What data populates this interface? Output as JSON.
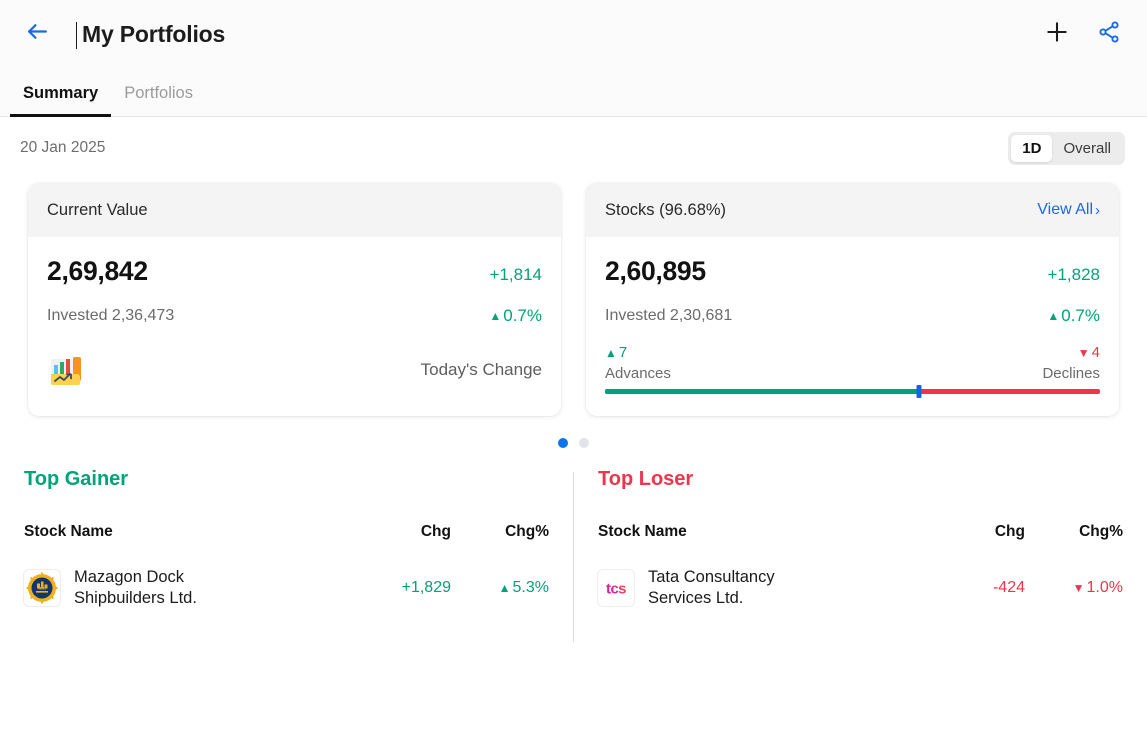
{
  "header": {
    "title": "My Portfolios",
    "back_icon": "arrow-left-icon",
    "add_icon": "plus-icon",
    "share_icon": "share-icon"
  },
  "tabs": [
    {
      "label": "Summary",
      "active": true
    },
    {
      "label": "Portfolios",
      "active": false
    }
  ],
  "subbar": {
    "date": "20 Jan 2025",
    "range_options": [
      {
        "label": "1D",
        "active": true
      },
      {
        "label": "Overall",
        "active": false
      }
    ]
  },
  "cards": {
    "current_value": {
      "header_title": "Current Value",
      "value": "2,69,842",
      "delta": "+1,814",
      "invested": "Invested 2,36,473",
      "pct": "0.7%",
      "pct_direction": "up",
      "icon": "bar-chart-emoji",
      "footer_label": "Today's Change"
    },
    "stocks": {
      "header_title": "Stocks (96.68%)",
      "view_all": "View All",
      "view_all_chevron": "›",
      "value": "2,60,895",
      "delta": "+1,828",
      "invested": "Invested 2,30,681",
      "pct": "0.7%",
      "pct_direction": "up",
      "advances_count": "7",
      "declines_count": "4",
      "advances_label": "Advances",
      "declines_label": "Declines",
      "advances_bar_percent": 63.5
    }
  },
  "carousel": {
    "dots": [
      {
        "active": true
      },
      {
        "active": false
      }
    ]
  },
  "top_gainer": {
    "title": "Top Gainer",
    "columns": {
      "name": "Stock Name",
      "chg": "Chg",
      "chg_pct": "Chg%"
    },
    "rows": [
      {
        "logo": "mazagon-dock-logo",
        "name_line1": "Mazagon Dock",
        "name_line2": "Shipbuilders Ltd.",
        "chg": "+1,829",
        "chg_pct": "5.3%",
        "direction": "up"
      }
    ]
  },
  "top_loser": {
    "title": "Top Loser",
    "columns": {
      "name": "Stock Name",
      "chg": "Chg",
      "chg_pct": "Chg%"
    },
    "rows": [
      {
        "logo": "tcs-logo",
        "name_line1": "Tata Consultancy",
        "name_line2": "Services Ltd.",
        "chg": "-424",
        "chg_pct": "1.0%",
        "direction": "down"
      }
    ]
  },
  "colors": {
    "positive": "#00a37a",
    "negative": "#f0344b",
    "link": "#1a6ae0",
    "accent_blue": "#0a74f0"
  }
}
